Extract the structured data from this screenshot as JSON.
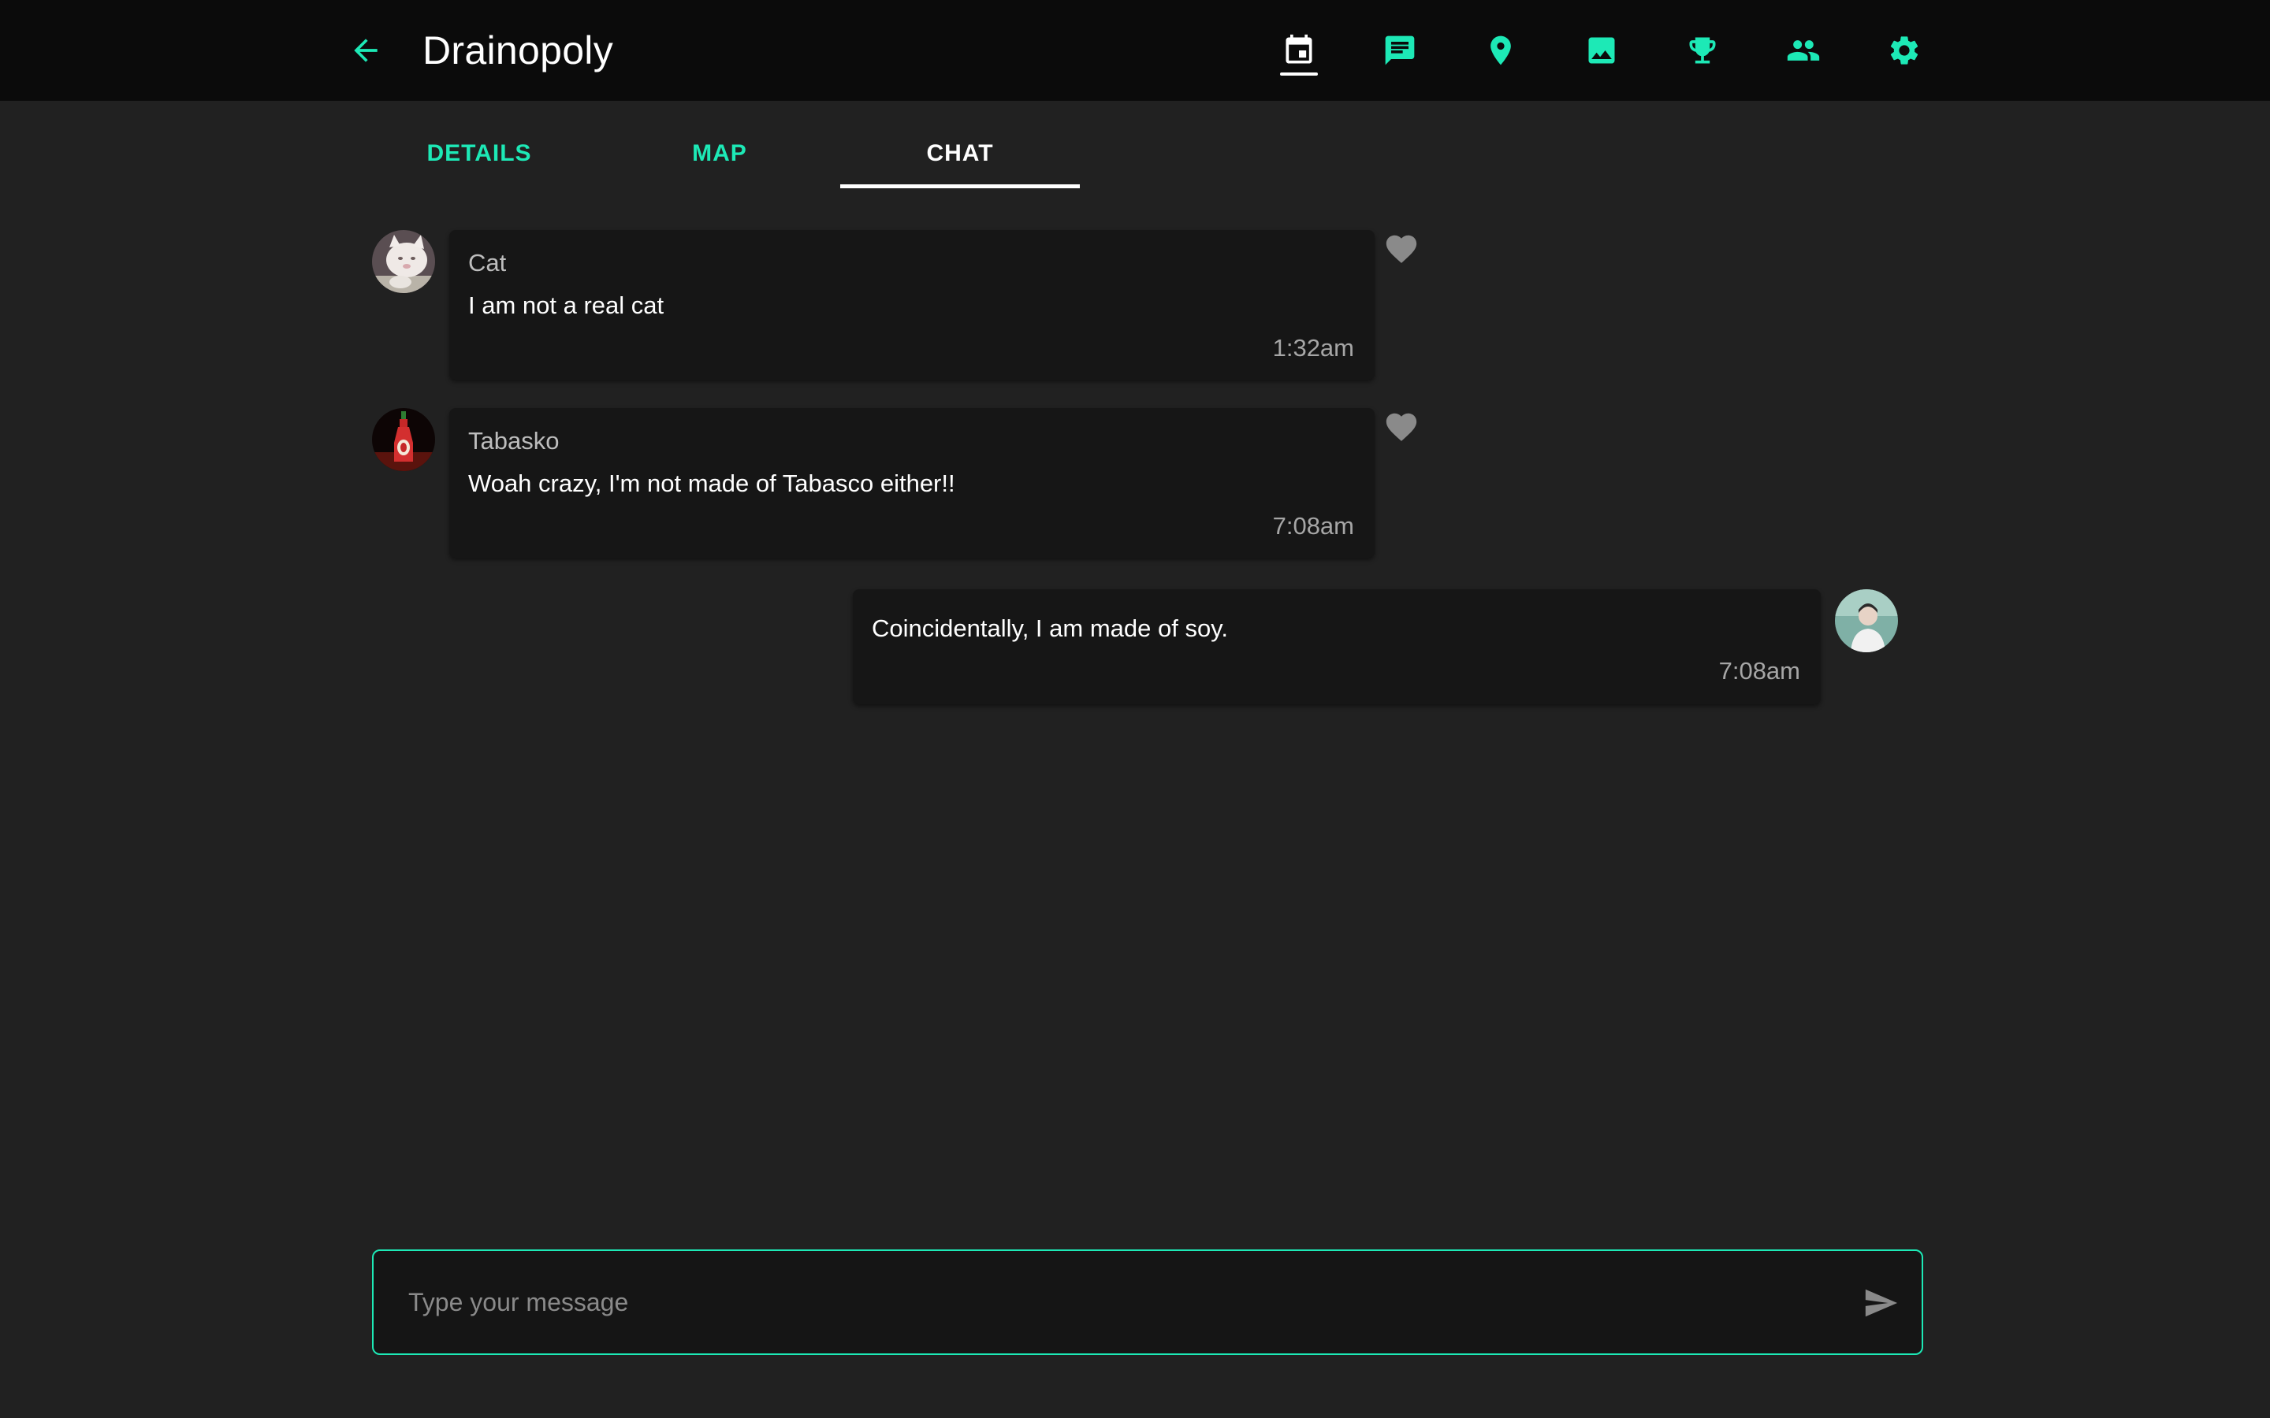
{
  "colors": {
    "accent": "#1de9b6",
    "appbar_bg": "#0b0b0b",
    "page_bg": "#212121",
    "bubble_bg": "#161616"
  },
  "appbar": {
    "title": "Drainopoly",
    "back_icon": "arrow-back-icon",
    "actions": [
      {
        "icon": "event-icon",
        "active": true
      },
      {
        "icon": "chat-icon",
        "active": false
      },
      {
        "icon": "location-pin-icon",
        "active": false
      },
      {
        "icon": "image-icon",
        "active": false
      },
      {
        "icon": "trophy-icon",
        "active": false
      },
      {
        "icon": "people-icon",
        "active": false
      },
      {
        "icon": "settings-icon",
        "active": false
      }
    ]
  },
  "tabs": [
    {
      "label": "DETAILS",
      "active": false
    },
    {
      "label": "MAP",
      "active": false
    },
    {
      "label": "CHAT",
      "active": true
    }
  ],
  "messages": [
    {
      "author": "Cat",
      "text": "I am not a real cat",
      "time": "1:32am",
      "own": false,
      "avatar": "cat-avatar"
    },
    {
      "author": "Tabasko",
      "text": "Woah crazy, I'm not made of Tabasco either!!",
      "time": "7:08am",
      "own": false,
      "avatar": "tabasco-bottle-avatar"
    },
    {
      "author": "",
      "text": "Coincidentally, I am made of soy.",
      "time": "7:08am",
      "own": true,
      "avatar": "user-avatar"
    }
  ],
  "composer": {
    "placeholder": "Type your message",
    "value": "",
    "send_icon": "send-icon"
  }
}
